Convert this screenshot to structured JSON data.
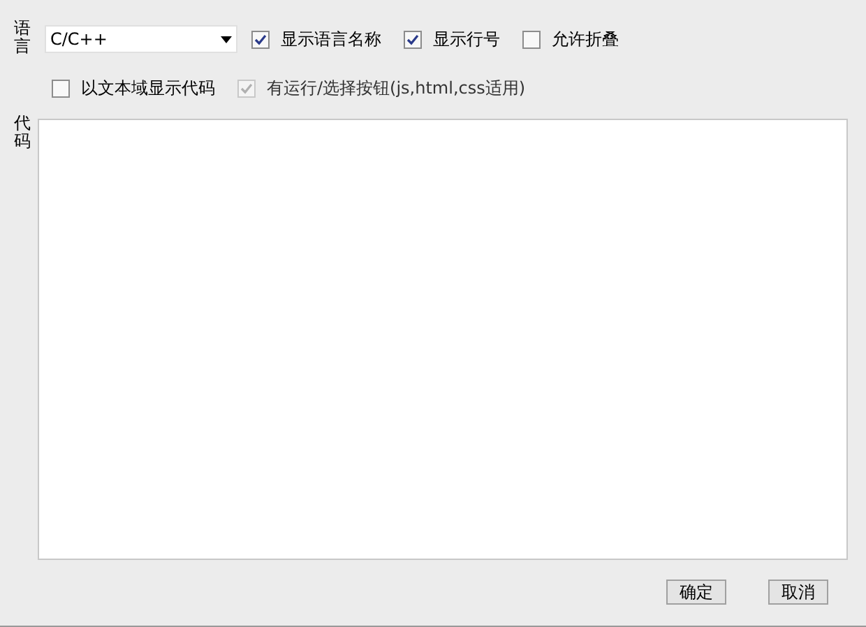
{
  "language": {
    "label": "语言",
    "value": "C/C++"
  },
  "options_row_1": [
    {
      "label": "显示语言名称",
      "checked": true,
      "disabled": false
    },
    {
      "label": "显示行号",
      "checked": true,
      "disabled": false
    },
    {
      "label": "允许折叠",
      "checked": false,
      "disabled": false
    }
  ],
  "options_row_2": [
    {
      "label": "以文本域显示代码",
      "checked": false,
      "disabled": false
    },
    {
      "label": "有运行/选择按钮(js,html,css适用)",
      "checked": true,
      "disabled": true
    }
  ],
  "code": {
    "label": "代码"
  },
  "buttons": [
    "确定",
    "取消"
  ]
}
